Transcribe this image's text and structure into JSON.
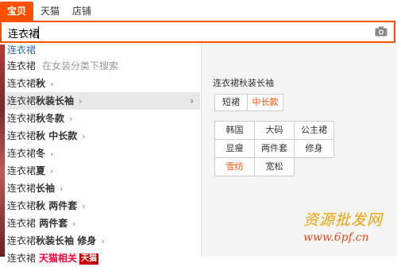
{
  "tabs": [
    {
      "label": "宝贝",
      "active": true
    },
    {
      "label": "天猫",
      "active": false
    },
    {
      "label": "店铺",
      "active": false
    }
  ],
  "search": {
    "value": "连衣裙"
  },
  "icons": {
    "camera": "camera-icon",
    "arrow": "chevron-right-icon"
  },
  "suggestions": [
    {
      "base": "连衣裙",
      "bold": "",
      "hint": "",
      "arrow": false,
      "style": "first"
    },
    {
      "base": "连衣裙",
      "bold": "",
      "hint": "在女装分类下搜索",
      "arrow": false
    },
    {
      "base": "连衣裙",
      "bold": "秋",
      "hint": "",
      "arrow": true
    },
    {
      "base": "连衣裙",
      "bold": "秋装长袖",
      "hint": "",
      "arrow": true,
      "highlight": true
    },
    {
      "base": "连衣裙",
      "bold": "秋冬款",
      "hint": "",
      "arrow": true
    },
    {
      "base": "连衣裙",
      "bold": "秋 中长款",
      "hint": "",
      "arrow": true
    },
    {
      "base": "连衣裙",
      "bold": "冬",
      "hint": "",
      "arrow": true
    },
    {
      "base": "连衣裙",
      "bold": "夏",
      "hint": "",
      "arrow": true
    },
    {
      "base": "连衣裙",
      "bold": "长袖",
      "hint": "",
      "arrow": true
    },
    {
      "base": "连衣裙",
      "bold": "秋 两件套",
      "hint": "",
      "arrow": true
    },
    {
      "base": "连衣裙",
      "bold": " 两件套",
      "hint": "",
      "arrow": true
    },
    {
      "base": "连衣裙",
      "bold": "秋装长袖 修身",
      "hint": "",
      "arrow": true
    },
    {
      "base": "连衣裙",
      "bold": "",
      "tmall": "天猫相关",
      "tmall_logo": "天猫",
      "arrow": false
    }
  ],
  "side_panel": {
    "title": "连衣裙秋装长袖",
    "length_options": [
      {
        "label": "短裙",
        "selected": false
      },
      {
        "label": "中长款",
        "selected": true
      }
    ],
    "attributes": [
      {
        "label": "韩国",
        "selected": false
      },
      {
        "label": "大码",
        "selected": false
      },
      {
        "label": "公主裙",
        "selected": false
      },
      {
        "label": "显瘦",
        "selected": false
      },
      {
        "label": "两件套",
        "selected": false
      },
      {
        "label": "修身",
        "selected": false
      },
      {
        "label": "雪纺",
        "selected": true
      },
      {
        "label": "宽松",
        "selected": false
      }
    ]
  },
  "watermark": {
    "title": "资源批发网",
    "url": "www.6pf.cn"
  },
  "colors": {
    "accent": "#ff5000",
    "tmall_red": "#c40000",
    "link_blue": "#2c6bb8"
  }
}
